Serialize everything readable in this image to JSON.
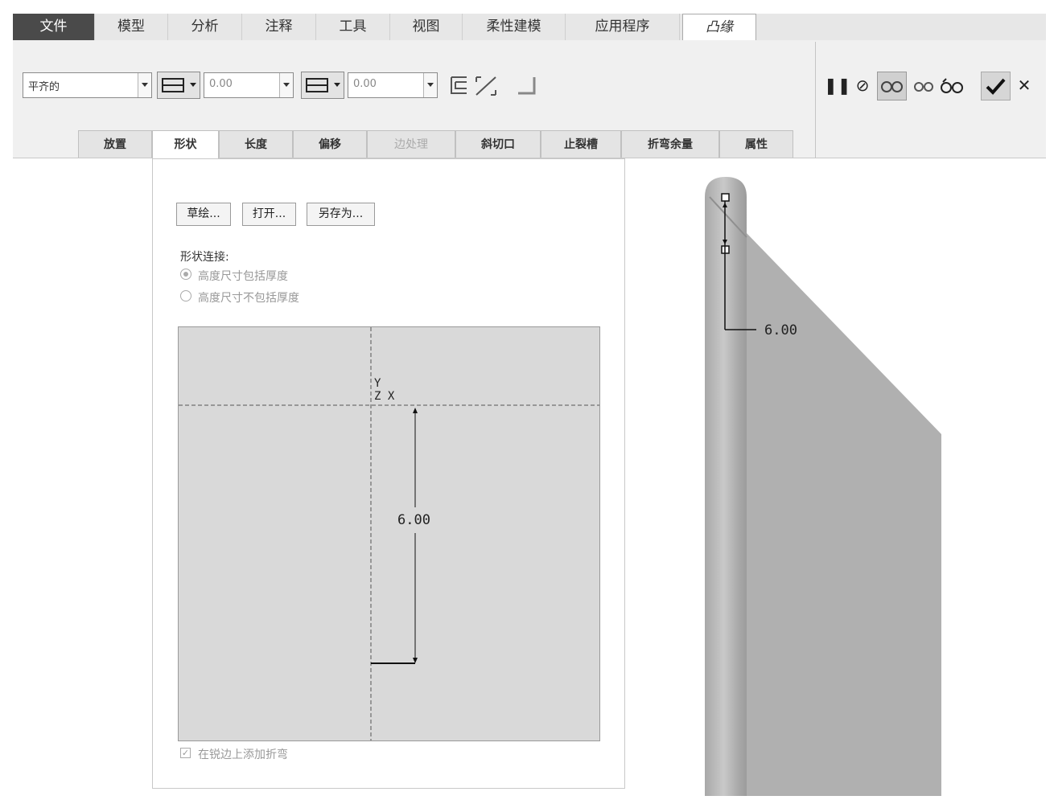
{
  "menu": {
    "tabs": [
      "文件",
      "模型",
      "分析",
      "注释",
      "工具",
      "视图",
      "柔性建模",
      "应用程序",
      "凸缘"
    ]
  },
  "ribbon": {
    "attach_type": "平齐的",
    "offset1_value": "0.00",
    "offset2_value": "0.00"
  },
  "subtabs": [
    "放置",
    "形状",
    "长度",
    "偏移",
    "边处理",
    "斜切口",
    "止裂槽",
    "折弯余量",
    "属性"
  ],
  "panel": {
    "buttons": [
      "草绘...",
      "打开...",
      "另存为..."
    ],
    "shape_connect_label": "形状连接:",
    "radio_options": [
      "高度尺寸包括厚度",
      "高度尺寸不包括厚度"
    ],
    "preview": {
      "axis_y": "Y",
      "axis_zx": "Z X",
      "dimension": "6.00"
    },
    "checkbox_label": "在锐边上添加折弯"
  },
  "model_view": {
    "dimension": "6.00",
    "colors": {
      "part_fill": "#b0b0b0",
      "part_edge": "#9a9a9a"
    }
  }
}
